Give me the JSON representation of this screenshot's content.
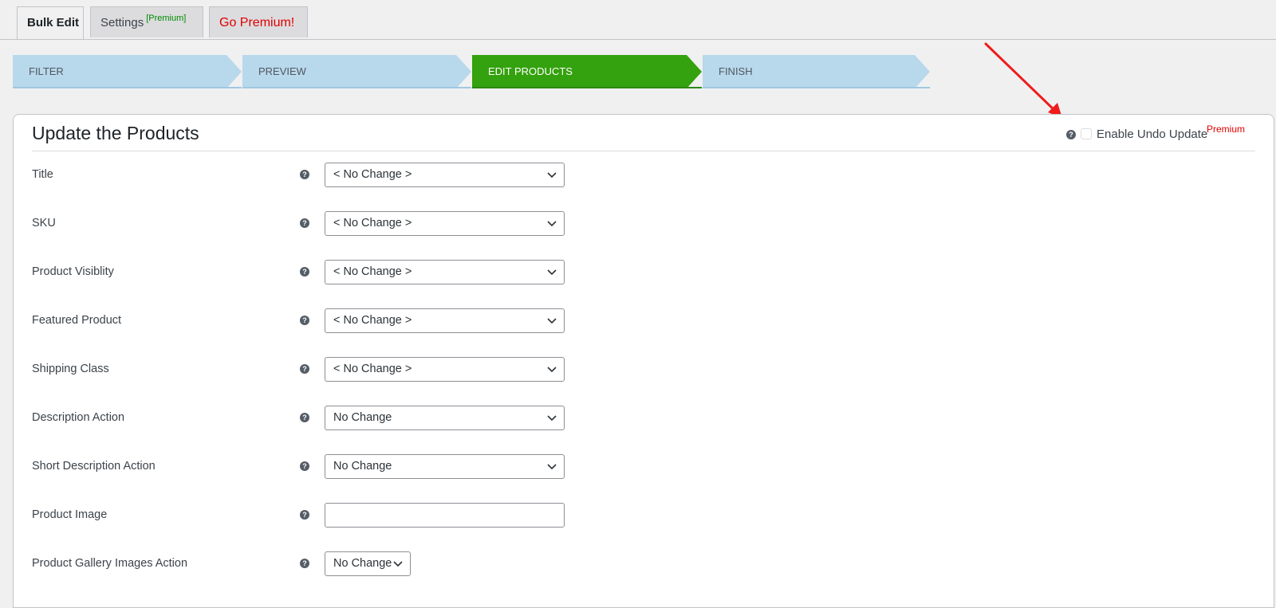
{
  "tabs": {
    "bulk_edit": "Bulk Edit",
    "settings": "Settings",
    "settings_badge": "[Premium]",
    "go_premium": "Go Premium!"
  },
  "steps": [
    "FILTER",
    "PREVIEW",
    "EDIT PRODUCTS",
    "FINISH"
  ],
  "active_step": "EDIT PRODUCTS",
  "colors": {
    "step_bg": "#b8d8ec",
    "step_active": "#34a10e",
    "premium_red": "#e00000",
    "badge_green": "#008a00",
    "annotation_arrow": "#ee1c1c"
  },
  "panel": {
    "title": "Update the Products",
    "help_glyph": "?",
    "undo_label": "Enable Undo Update",
    "undo_badge": "Premium",
    "undo_checked": false
  },
  "fields": [
    {
      "label": "Title",
      "value": "< No Change >"
    },
    {
      "label": "SKU",
      "value": "< No Change >"
    },
    {
      "label": "Product Visiblity",
      "value": "< No Change >"
    },
    {
      "label": "Featured Product",
      "value": "< No Change >"
    },
    {
      "label": "Shipping Class",
      "value": "< No Change >"
    },
    {
      "label": "Description Action",
      "value": "No Change"
    },
    {
      "label": "Short Description Action",
      "value": "No Change"
    },
    {
      "label": "Product Image",
      "value": ""
    },
    {
      "label": "Product Gallery Images Action",
      "value": "No Change"
    }
  ],
  "icons": {
    "help": "help-circle-icon",
    "dropdown": "chevron-down-icon",
    "annotation": "red-arrow-icon"
  }
}
